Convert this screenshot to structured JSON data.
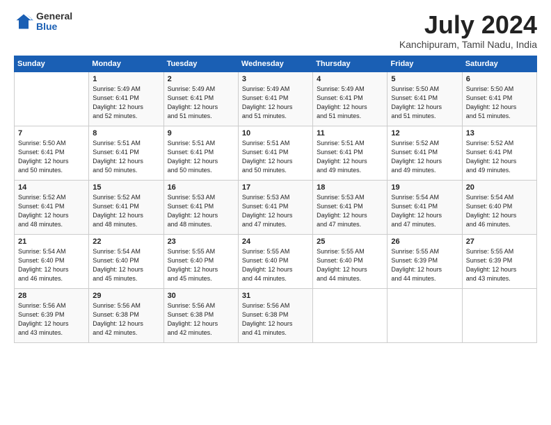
{
  "logo": {
    "general": "General",
    "blue": "Blue"
  },
  "title": {
    "month_year": "July 2024",
    "location": "Kanchipuram, Tamil Nadu, India"
  },
  "days_header": [
    "Sunday",
    "Monday",
    "Tuesday",
    "Wednesday",
    "Thursday",
    "Friday",
    "Saturday"
  ],
  "weeks": [
    [
      {
        "day": "",
        "info": ""
      },
      {
        "day": "1",
        "info": "Sunrise: 5:49 AM\nSunset: 6:41 PM\nDaylight: 12 hours\nand 52 minutes."
      },
      {
        "day": "2",
        "info": "Sunrise: 5:49 AM\nSunset: 6:41 PM\nDaylight: 12 hours\nand 51 minutes."
      },
      {
        "day": "3",
        "info": "Sunrise: 5:49 AM\nSunset: 6:41 PM\nDaylight: 12 hours\nand 51 minutes."
      },
      {
        "day": "4",
        "info": "Sunrise: 5:49 AM\nSunset: 6:41 PM\nDaylight: 12 hours\nand 51 minutes."
      },
      {
        "day": "5",
        "info": "Sunrise: 5:50 AM\nSunset: 6:41 PM\nDaylight: 12 hours\nand 51 minutes."
      },
      {
        "day": "6",
        "info": "Sunrise: 5:50 AM\nSunset: 6:41 PM\nDaylight: 12 hours\nand 51 minutes."
      }
    ],
    [
      {
        "day": "7",
        "info": "Sunrise: 5:50 AM\nSunset: 6:41 PM\nDaylight: 12 hours\nand 50 minutes."
      },
      {
        "day": "8",
        "info": "Sunrise: 5:51 AM\nSunset: 6:41 PM\nDaylight: 12 hours\nand 50 minutes."
      },
      {
        "day": "9",
        "info": "Sunrise: 5:51 AM\nSunset: 6:41 PM\nDaylight: 12 hours\nand 50 minutes."
      },
      {
        "day": "10",
        "info": "Sunrise: 5:51 AM\nSunset: 6:41 PM\nDaylight: 12 hours\nand 50 minutes."
      },
      {
        "day": "11",
        "info": "Sunrise: 5:51 AM\nSunset: 6:41 PM\nDaylight: 12 hours\nand 49 minutes."
      },
      {
        "day": "12",
        "info": "Sunrise: 5:52 AM\nSunset: 6:41 PM\nDaylight: 12 hours\nand 49 minutes."
      },
      {
        "day": "13",
        "info": "Sunrise: 5:52 AM\nSunset: 6:41 PM\nDaylight: 12 hours\nand 49 minutes."
      }
    ],
    [
      {
        "day": "14",
        "info": "Sunrise: 5:52 AM\nSunset: 6:41 PM\nDaylight: 12 hours\nand 48 minutes."
      },
      {
        "day": "15",
        "info": "Sunrise: 5:52 AM\nSunset: 6:41 PM\nDaylight: 12 hours\nand 48 minutes."
      },
      {
        "day": "16",
        "info": "Sunrise: 5:53 AM\nSunset: 6:41 PM\nDaylight: 12 hours\nand 48 minutes."
      },
      {
        "day": "17",
        "info": "Sunrise: 5:53 AM\nSunset: 6:41 PM\nDaylight: 12 hours\nand 47 minutes."
      },
      {
        "day": "18",
        "info": "Sunrise: 5:53 AM\nSunset: 6:41 PM\nDaylight: 12 hours\nand 47 minutes."
      },
      {
        "day": "19",
        "info": "Sunrise: 5:54 AM\nSunset: 6:41 PM\nDaylight: 12 hours\nand 47 minutes."
      },
      {
        "day": "20",
        "info": "Sunrise: 5:54 AM\nSunset: 6:40 PM\nDaylight: 12 hours\nand 46 minutes."
      }
    ],
    [
      {
        "day": "21",
        "info": "Sunrise: 5:54 AM\nSunset: 6:40 PM\nDaylight: 12 hours\nand 46 minutes."
      },
      {
        "day": "22",
        "info": "Sunrise: 5:54 AM\nSunset: 6:40 PM\nDaylight: 12 hours\nand 45 minutes."
      },
      {
        "day": "23",
        "info": "Sunrise: 5:55 AM\nSunset: 6:40 PM\nDaylight: 12 hours\nand 45 minutes."
      },
      {
        "day": "24",
        "info": "Sunrise: 5:55 AM\nSunset: 6:40 PM\nDaylight: 12 hours\nand 44 minutes."
      },
      {
        "day": "25",
        "info": "Sunrise: 5:55 AM\nSunset: 6:40 PM\nDaylight: 12 hours\nand 44 minutes."
      },
      {
        "day": "26",
        "info": "Sunrise: 5:55 AM\nSunset: 6:39 PM\nDaylight: 12 hours\nand 44 minutes."
      },
      {
        "day": "27",
        "info": "Sunrise: 5:55 AM\nSunset: 6:39 PM\nDaylight: 12 hours\nand 43 minutes."
      }
    ],
    [
      {
        "day": "28",
        "info": "Sunrise: 5:56 AM\nSunset: 6:39 PM\nDaylight: 12 hours\nand 43 minutes."
      },
      {
        "day": "29",
        "info": "Sunrise: 5:56 AM\nSunset: 6:38 PM\nDaylight: 12 hours\nand 42 minutes."
      },
      {
        "day": "30",
        "info": "Sunrise: 5:56 AM\nSunset: 6:38 PM\nDaylight: 12 hours\nand 42 minutes."
      },
      {
        "day": "31",
        "info": "Sunrise: 5:56 AM\nSunset: 6:38 PM\nDaylight: 12 hours\nand 41 minutes."
      },
      {
        "day": "",
        "info": ""
      },
      {
        "day": "",
        "info": ""
      },
      {
        "day": "",
        "info": ""
      }
    ]
  ]
}
